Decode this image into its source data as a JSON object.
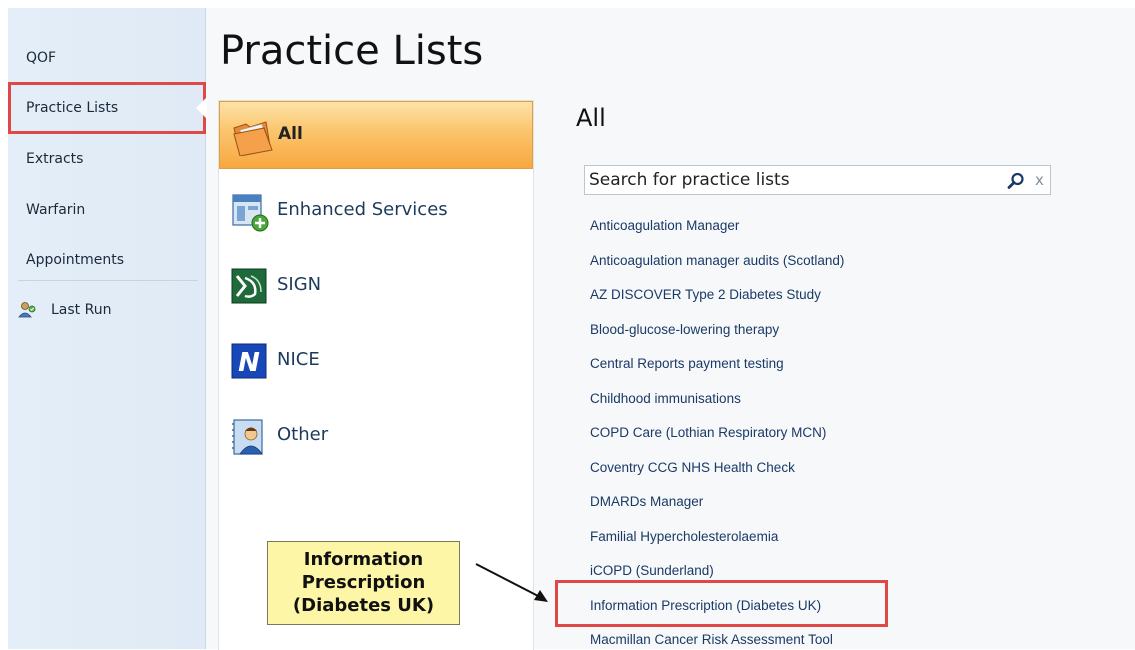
{
  "nav": {
    "items": [
      {
        "label": "QOF"
      },
      {
        "label": "Practice Lists"
      },
      {
        "label": "Extracts"
      },
      {
        "label": "Warfarin"
      },
      {
        "label": "Appointments"
      }
    ],
    "last_run": "Last Run",
    "selected": "Practice Lists"
  },
  "page": {
    "title": "Practice Lists"
  },
  "categories": [
    {
      "label": "All",
      "icon": "folder-icon"
    },
    {
      "label": "Enhanced Services",
      "icon": "enhanced-services-icon"
    },
    {
      "label": "SIGN",
      "icon": "sign-icon"
    },
    {
      "label": "NICE",
      "icon": "nice-icon"
    },
    {
      "label": "Other",
      "icon": "other-icon"
    }
  ],
  "list_panel": {
    "heading": "All",
    "search_placeholder": "Search for practice lists",
    "clear_label": "x",
    "items": [
      "Anticoagulation Manager",
      "Anticoagulation manager audits (Scotland)",
      "AZ DISCOVER Type 2 Diabetes Study",
      "Blood-glucose-lowering therapy",
      "Central Reports payment testing",
      "Childhood immunisations",
      "COPD Care (Lothian Respiratory MCN)",
      "Coventry CCG NHS Health Check",
      "DMARDs Manager",
      "Familial Hypercholesterolaemia",
      "iCOPD (Sunderland)",
      "Information Prescription (Diabetes UK)",
      "Macmillan Cancer Risk Assessment Tool"
    ]
  },
  "callout": {
    "lines": [
      "Information",
      "Prescription",
      "(Diabetes UK)"
    ]
  },
  "colors": {
    "highlight_border": "#e04848",
    "selected_category": "#f8a840",
    "callout_bg": "#fdf6a6",
    "nav_bg": "#e4eef8"
  }
}
